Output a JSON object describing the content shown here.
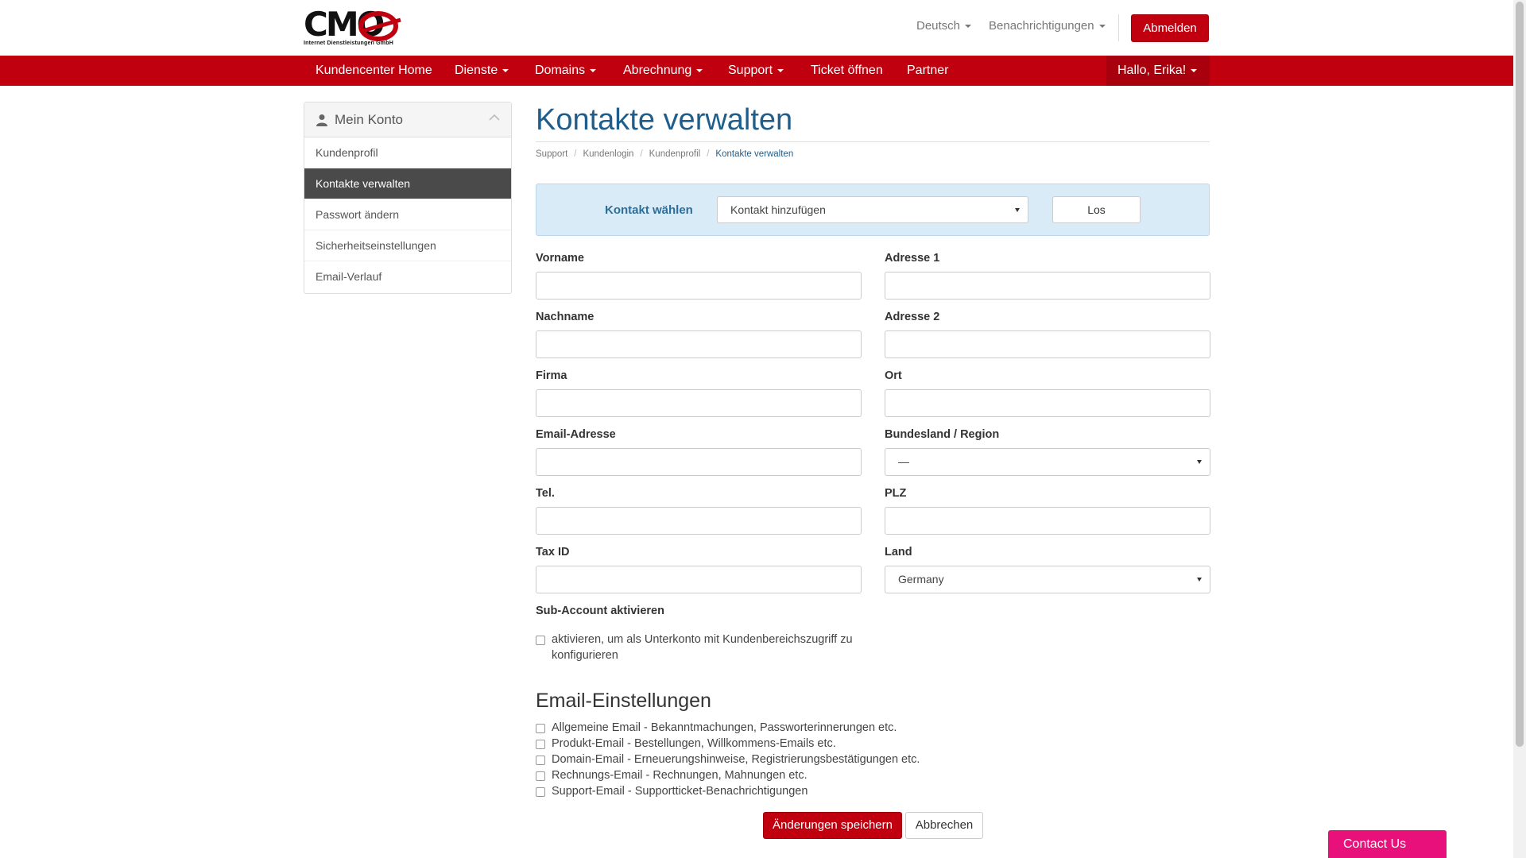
{
  "brand": {
    "logo_text": "CMO",
    "logo_subtitle": "Internet Dienstleistungen GmbH",
    "accent_color": "#c1000f",
    "link_color": "#1f5e8c"
  },
  "header": {
    "language": "Deutsch",
    "notifications": "Benachrichtigungen",
    "logout": "Abmelden"
  },
  "nav": {
    "home": "Kundencenter Home",
    "services": "Dienste",
    "domains": "Domains",
    "billing": "Abrechnung",
    "support": "Support",
    "open_ticket": "Ticket öffnen",
    "partner": "Partner",
    "user": "Hallo, Erika!"
  },
  "sidebar": {
    "title": "Mein Konto",
    "items": [
      {
        "label": "Kundenprofil"
      },
      {
        "label": "Kontakte verwalten"
      },
      {
        "label": "Passwort ändern"
      },
      {
        "label": "Sicherheitseinstellungen"
      },
      {
        "label": "Email-Verlauf"
      }
    ],
    "active_index": 1
  },
  "page": {
    "title": "Kontakte verwalten",
    "breadcrumb": [
      "Support",
      "Kundenlogin",
      "Kundenprofil",
      "Kontakte verwalten"
    ]
  },
  "contact_select": {
    "label": "Kontakt wählen",
    "selected": "Kontakt hinzufügen",
    "button": "Los"
  },
  "form": {
    "first_name": {
      "label": "Vorname",
      "value": ""
    },
    "last_name": {
      "label": "Nachname",
      "value": ""
    },
    "company": {
      "label": "Firma",
      "value": ""
    },
    "email": {
      "label": "Email-Adresse",
      "value": ""
    },
    "phone": {
      "label": "Tel.",
      "value": ""
    },
    "tax_id": {
      "label": "Tax ID",
      "value": ""
    },
    "address1": {
      "label": "Adresse 1",
      "value": ""
    },
    "address2": {
      "label": "Adresse 2",
      "value": ""
    },
    "city": {
      "label": "Ort",
      "value": ""
    },
    "state": {
      "label": "Bundesland / Region",
      "value": "—"
    },
    "postcode": {
      "label": "PLZ",
      "value": ""
    },
    "country": {
      "label": "Land",
      "value": "Germany"
    },
    "subaccount": {
      "label": "Sub-Account aktivieren",
      "checkbox_text_line1": "aktivieren, um als Unterkonto mit Kundenbereichszugriff zu",
      "checkbox_text_line2": "konfigurieren",
      "checked": false
    }
  },
  "email_settings": {
    "title": "Email-Einstellungen",
    "options": [
      {
        "label": "Allgemeine Email - Bekanntmachungen, Passworterinnerungen etc.",
        "checked": false
      },
      {
        "label": "Produkt-Email - Bestellungen, Willkommens-Emails etc.",
        "checked": false
      },
      {
        "label": "Domain-Email - Erneuerungshinweise, Registrierungsbestätigungen etc.",
        "checked": false
      },
      {
        "label": "Rechnungs-Email - Rechnungen, Mahnungen etc.",
        "checked": false
      },
      {
        "label": "Support-Email - Supportticket-Benachrichtigungen",
        "checked": false
      }
    ]
  },
  "actions": {
    "save": "Änderungen speichern",
    "cancel": "Abbrechen"
  },
  "widget": {
    "contact_us": "Contact Us",
    "color": "#e8107a"
  }
}
